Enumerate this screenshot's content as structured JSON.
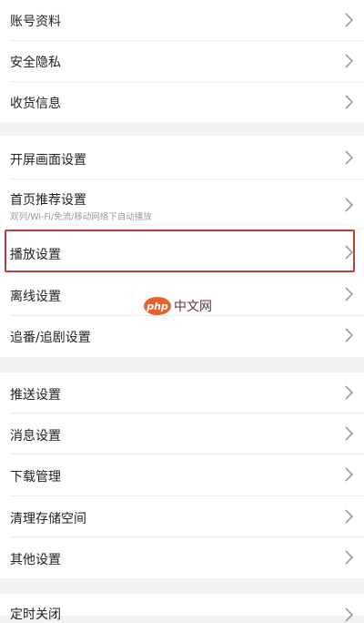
{
  "groups": [
    {
      "items": [
        {
          "label": "账号资料",
          "sub": ""
        },
        {
          "label": "安全隐私",
          "sub": ""
        },
        {
          "label": "收货信息",
          "sub": ""
        }
      ]
    },
    {
      "items": [
        {
          "label": "开屏画面设置",
          "sub": ""
        },
        {
          "label": "首页推荐设置",
          "sub": "双列/Wi-Fi/免流/移动网络下自动播放"
        },
        {
          "label": "播放设置",
          "sub": "",
          "highlighted": true
        },
        {
          "label": "离线设置",
          "sub": ""
        },
        {
          "label": "追番/追剧设置",
          "sub": ""
        }
      ]
    },
    {
      "items": [
        {
          "label": "推送设置",
          "sub": ""
        },
        {
          "label": "消息设置",
          "sub": ""
        },
        {
          "label": "下载管理",
          "sub": ""
        },
        {
          "label": "清理存储空间",
          "sub": ""
        },
        {
          "label": "其他设置",
          "sub": ""
        }
      ]
    },
    {
      "items": [
        {
          "label": "定时关闭",
          "sub": ""
        }
      ]
    }
  ],
  "watermark": {
    "logo_text": "php",
    "site_text": "中文网"
  },
  "colors": {
    "background": "#f2f2f4",
    "highlight_border": "#b5443d",
    "watermark_accent": "#e7622d"
  },
  "icons": {
    "row_action": "chevron-right-icon"
  }
}
